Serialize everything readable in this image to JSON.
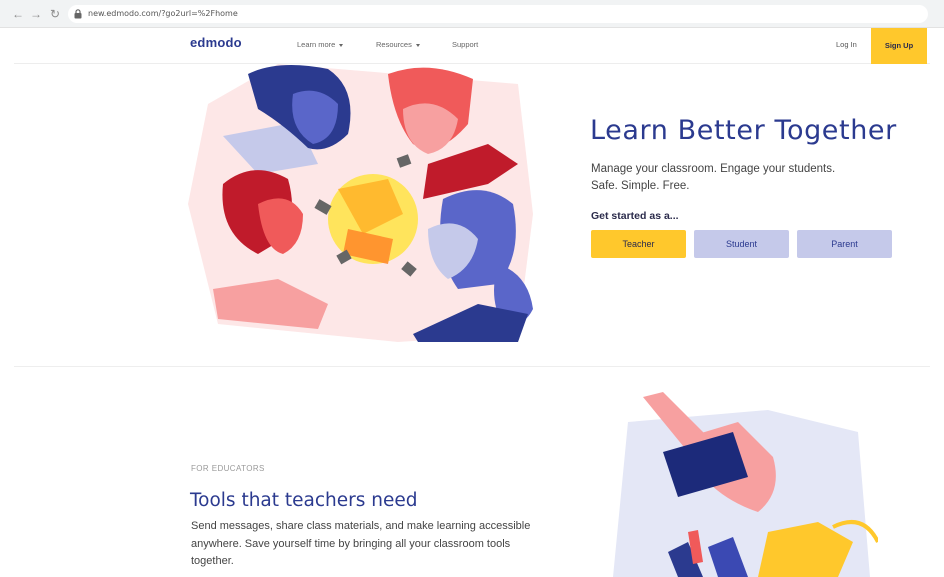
{
  "browser": {
    "url": "new.edmodo.com/?go2url=%2Fhome"
  },
  "header": {
    "logo": "edmodo",
    "menu": [
      {
        "label": "Learn more",
        "has_dropdown": true
      },
      {
        "label": "Resources",
        "has_dropdown": true
      },
      {
        "label": "Support",
        "has_dropdown": false
      }
    ],
    "login_label": "Log In",
    "signup_label": "Sign Up"
  },
  "hero": {
    "title": "Learn Better Together",
    "subtitle_line1": "Manage your classroom. Engage your students.",
    "subtitle_line2": "Safe. Simple. Free.",
    "get_started": "Get started as a...",
    "roles": {
      "teacher": "Teacher",
      "student": "Student",
      "parent": "Parent"
    }
  },
  "educators": {
    "eyebrow": "FOR EDUCATORS",
    "title": "Tools that teachers need",
    "body": "Send messages, share class materials, and make learning accessible anywhere. Save yourself time by bringing all your classroom tools together."
  },
  "colors": {
    "brand_blue": "#2b3a8f",
    "accent_yellow": "#ffc82c",
    "role_button": "#c5c9ea"
  }
}
